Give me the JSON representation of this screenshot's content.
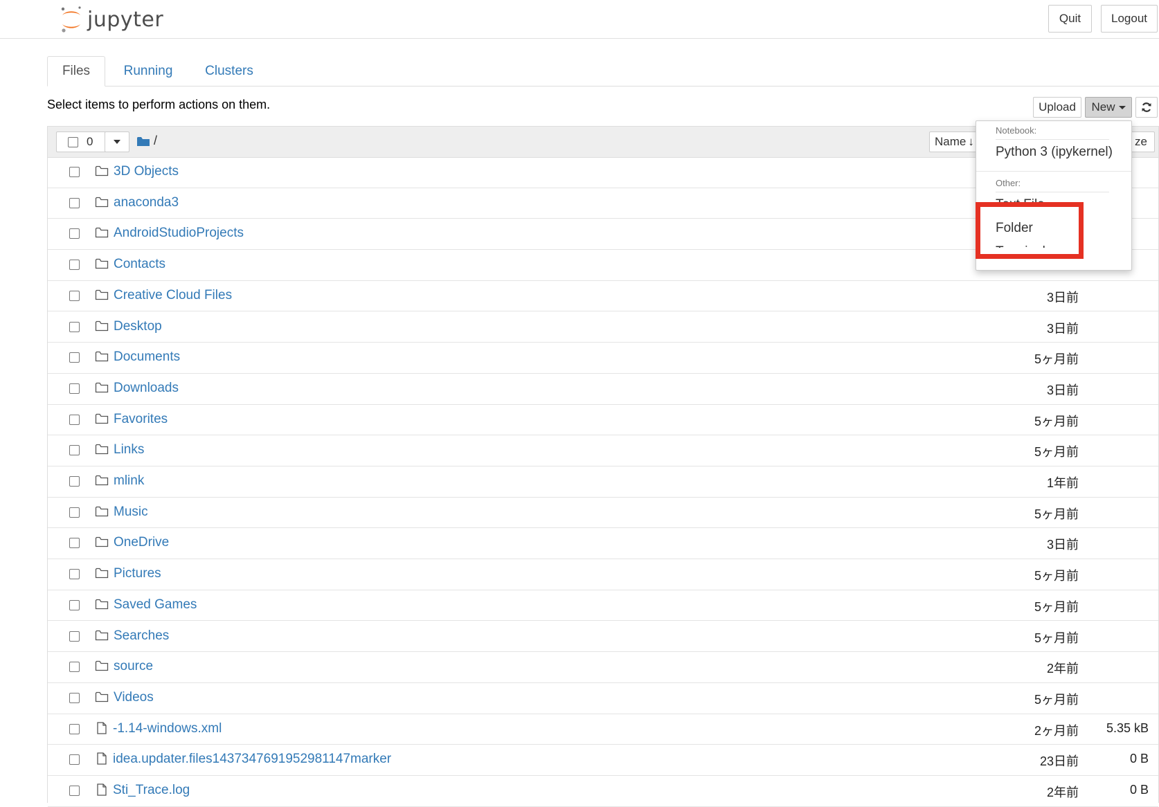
{
  "header": {
    "logo_text": "jupyter",
    "quit_label": "Quit",
    "logout_label": "Logout"
  },
  "tabs": [
    {
      "label": "Files",
      "active": true
    },
    {
      "label": "Running",
      "active": false
    },
    {
      "label": "Clusters",
      "active": false
    }
  ],
  "instructions": "Select items to perform actions on them.",
  "toolbar": {
    "upload_label": "Upload",
    "new_label": "New",
    "refresh_icon": "refresh-icon"
  },
  "list_header": {
    "selected_count": "0",
    "path": "/",
    "sort_name_label": "Name",
    "sort_arrow": "↓",
    "size_label_partial": "ze"
  },
  "new_menu": {
    "notebook_header": "Notebook:",
    "python_kernel": "Python 3 (ipykernel)",
    "other_header": "Other:",
    "text_file": "Text File",
    "folder": "Folder",
    "terminal": "Terminal"
  },
  "files": [
    {
      "name": "3D Objects",
      "type": "folder",
      "modified": "",
      "size": ""
    },
    {
      "name": "anaconda3",
      "type": "folder",
      "modified": "",
      "size": ""
    },
    {
      "name": "AndroidStudioProjects",
      "type": "folder",
      "modified": "",
      "size": ""
    },
    {
      "name": "Contacts",
      "type": "folder",
      "modified": "",
      "size": ""
    },
    {
      "name": "Creative Cloud Files",
      "type": "folder",
      "modified": "3日前",
      "size": ""
    },
    {
      "name": "Desktop",
      "type": "folder",
      "modified": "3日前",
      "size": ""
    },
    {
      "name": "Documents",
      "type": "folder",
      "modified": "5ヶ月前",
      "size": ""
    },
    {
      "name": "Downloads",
      "type": "folder",
      "modified": "3日前",
      "size": ""
    },
    {
      "name": "Favorites",
      "type": "folder",
      "modified": "5ヶ月前",
      "size": ""
    },
    {
      "name": "Links",
      "type": "folder",
      "modified": "5ヶ月前",
      "size": ""
    },
    {
      "name": "mlink",
      "type": "folder",
      "modified": "1年前",
      "size": ""
    },
    {
      "name": "Music",
      "type": "folder",
      "modified": "5ヶ月前",
      "size": ""
    },
    {
      "name": "OneDrive",
      "type": "folder",
      "modified": "3日前",
      "size": ""
    },
    {
      "name": "Pictures",
      "type": "folder",
      "modified": "5ヶ月前",
      "size": ""
    },
    {
      "name": "Saved Games",
      "type": "folder",
      "modified": "5ヶ月前",
      "size": ""
    },
    {
      "name": "Searches",
      "type": "folder",
      "modified": "5ヶ月前",
      "size": ""
    },
    {
      "name": "source",
      "type": "folder",
      "modified": "2年前",
      "size": ""
    },
    {
      "name": "Videos",
      "type": "folder",
      "modified": "5ヶ月前",
      "size": ""
    },
    {
      "name": "-1.14-windows.xml",
      "type": "file",
      "modified": "2ヶ月前",
      "size": "5.35 kB"
    },
    {
      "name": "idea.updater.files1437347691952981147marker",
      "type": "file",
      "modified": "23日前",
      "size": "0 B"
    },
    {
      "name": "Sti_Trace.log",
      "type": "file",
      "modified": "2年前",
      "size": "0 B"
    }
  ],
  "colors": {
    "link": "#337ab7",
    "highlight": "#e53123",
    "jupyter_orange": "#f37726"
  }
}
